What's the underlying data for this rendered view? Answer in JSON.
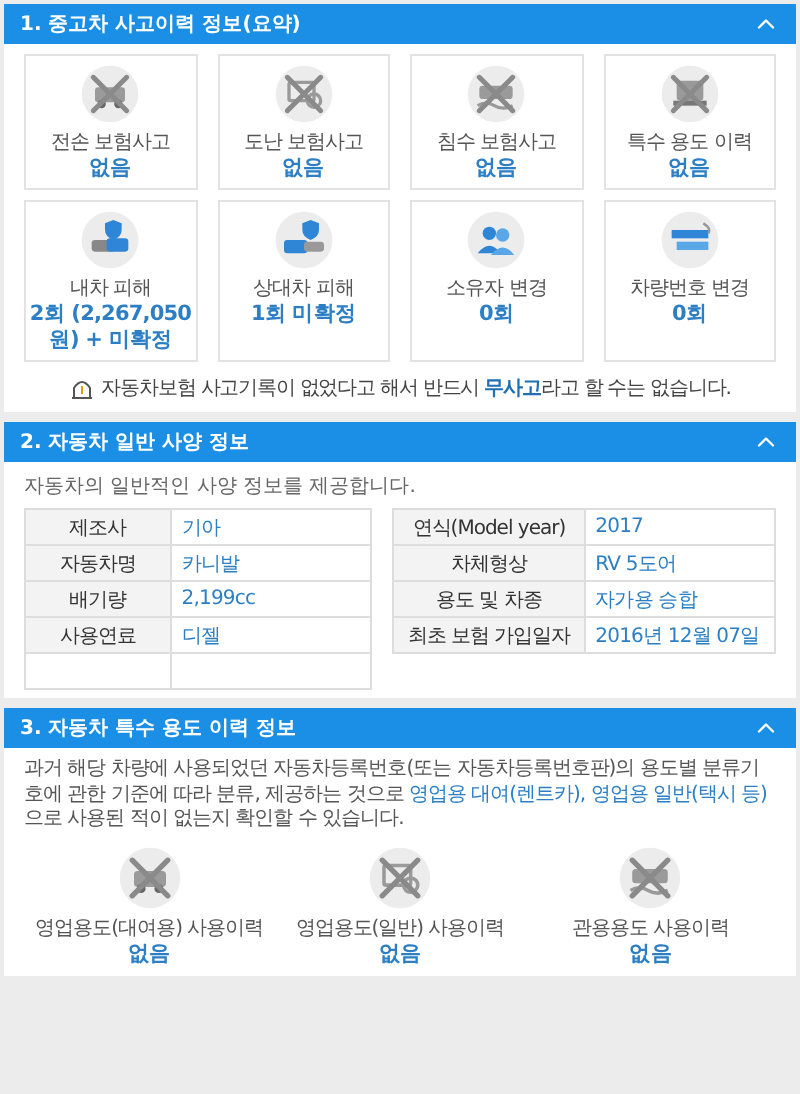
{
  "sections": [
    {
      "title": "1. 중고차 사고이력 정보(요약)",
      "expanded": true,
      "cards": [
        {
          "label": "전손 보험사고",
          "value": "없음",
          "crossed": true
        },
        {
          "label": "도난 보험사고",
          "value": "없음",
          "crossed": true
        },
        {
          "label": "침수 보험사고",
          "value": "없음",
          "crossed": true
        },
        {
          "label": "특수 용도 이력",
          "value": "없음",
          "crossed": true
        },
        {
          "label": "내차 피해",
          "value": "2회 (2,267,050 원) + 미확정",
          "crossed": false
        },
        {
          "label": "상대차 피해",
          "value": "1회 미확정",
          "crossed": false
        },
        {
          "label": "소유자 변경",
          "value": "0회",
          "crossed": false
        },
        {
          "label": "차량번호 변경",
          "value": "0회",
          "crossed": false
        }
      ],
      "notice": "자동차보험 사고기록이 없었다고 해서 반드시 **무사고**라고 할 수는 없습니다."
    },
    {
      "title": "2. 자동차 일반 사양 정보",
      "expanded": true,
      "description": "자동차의 일반적인 사양 정보를 제공합니다.",
      "tables": [
        [
          {
            "label": "제조사",
            "value": "기아"
          },
          {
            "label": "자동차명",
            "value": "카니발"
          },
          {
            "label": "배기량",
            "value": "2,199cc"
          },
          {
            "label": "사용연료",
            "value": "디젤"
          }
        ],
        [
          {
            "label": "연식(Model year)",
            "value": "2017"
          },
          {
            "label": "차체형상",
            "value": "RV 5도어"
          },
          {
            "label": "용도 및 차종",
            "value": "자가용 승합"
          },
          {
            "label": "최초 보험 가입일자",
            "value": "2016년 12월 07일"
          }
        ]
      ]
    },
    {
      "title": "3. 자동차 특수 용도 이력 정보",
      "expanded": true,
      "paragraph": {
        "before": "과거 해당 차량에 사용되었던 자동차등록번호(또는 자동차등록번호판)의 용도별 분류기호에 관한 기준에 따라 분류, 제공하는 것으로",
        "link": "영업용 대여(렌트카), 영업용 일반(택시 등)",
        "after": "으로 사용된 적이 없는지 확인할 수 있습니다."
      },
      "cards": [
        {
          "label": "영업용도(대여용) 사용이력",
          "value": "없음",
          "crossed": true
        },
        {
          "label": "영업용도(일반) 사용이력",
          "value": "없음",
          "crossed": true
        },
        {
          "label": "관용용도 사용이력",
          "value": "없음",
          "crossed": true
        }
      ]
    }
  ]
}
